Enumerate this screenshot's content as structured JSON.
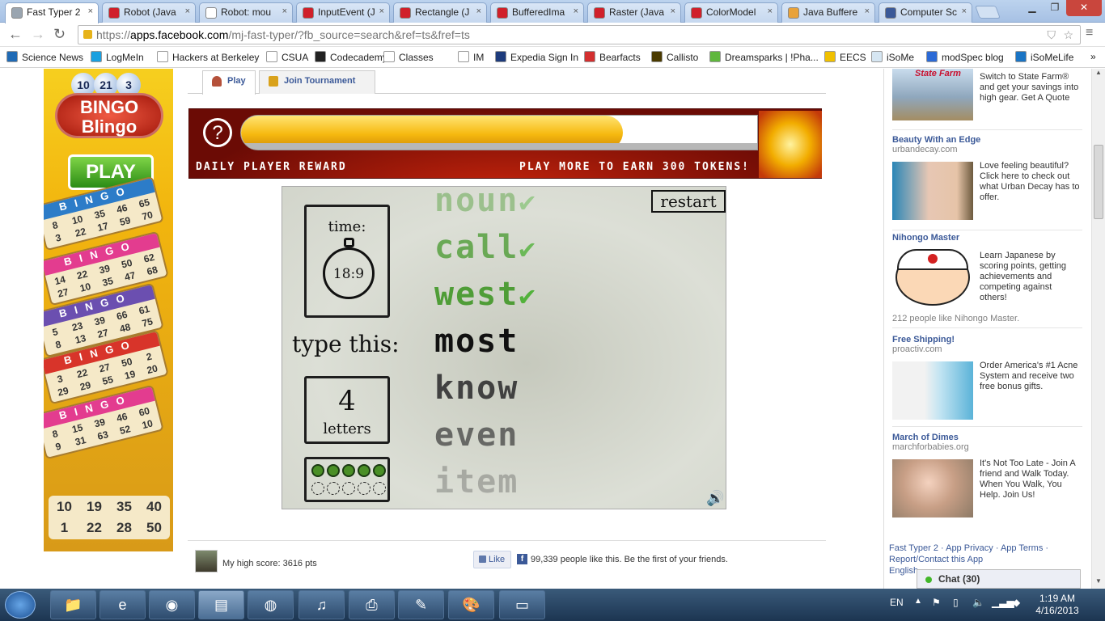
{
  "browser": {
    "tabs": [
      {
        "label": "Fast Typer 2",
        "color": "#9aa5b0",
        "active": true
      },
      {
        "label": "Robot (Java",
        "color": "#d0202a"
      },
      {
        "label": "Robot: mou",
        "color": "#ffffff"
      },
      {
        "label": "InputEvent (J",
        "color": "#d0202a"
      },
      {
        "label": "Rectangle (J",
        "color": "#d0202a"
      },
      {
        "label": "BufferedIma",
        "color": "#d0202a"
      },
      {
        "label": "Raster (Java",
        "color": "#d0202a"
      },
      {
        "label": "ColorModel",
        "color": "#d0202a"
      },
      {
        "label": "Java Buffere",
        "color": "#e8a23a"
      },
      {
        "label": "Computer Sc",
        "color": "#3b5998"
      }
    ],
    "url_prefix": "https://",
    "url_host": "apps.facebook.com",
    "url_path": "/mj-fast-typer/?fb_source=search&ref=ts&fref=ts",
    "bookmarks": [
      {
        "label": "Science News",
        "color": "#1f6ab5"
      },
      {
        "label": "LogMeIn",
        "color": "#1aa0e0"
      },
      {
        "label": "Hackers at Berkeley",
        "color": "#ffffff"
      },
      {
        "label": "CSUA",
        "color": "#ffffff"
      },
      {
        "label": "Codecademy",
        "color": "#222222"
      },
      {
        "label": "Classes",
        "color": "#ffffff"
      },
      {
        "label": "IM",
        "color": "#ffffff"
      },
      {
        "label": "Expedia Sign In",
        "color": "#1d3b7c"
      },
      {
        "label": "Bearfacts",
        "color": "#d32f2f"
      },
      {
        "label": "Callisto",
        "color": "#4a3a00"
      },
      {
        "label": "Dreamsparks | !Pha...",
        "color": "#5fb73d"
      },
      {
        "label": "EECS",
        "color": "#f0c000"
      },
      {
        "label": "iSoMe",
        "color": "#d6e6f2"
      },
      {
        "label": "modSpec blog",
        "color": "#2b6ad6"
      },
      {
        "label": "iSoMeLife",
        "color": "#1a74c4"
      }
    ]
  },
  "left_ad": {
    "ball_numbers": [
      "10",
      "21",
      "3"
    ],
    "logo": "BINGO\nBlingo",
    "play_label": "PLAY",
    "cards": [
      {
        "header": "BINGO",
        "color": "#2c7cc8",
        "nums": [
          "8",
          "10",
          "35",
          "46",
          "65",
          "3",
          "22",
          "17",
          "59",
          "70"
        ]
      },
      {
        "header": "BINGO",
        "color": "#e33c8f",
        "nums": [
          "14",
          "22",
          "39",
          "50",
          "62",
          "27",
          "10",
          "35",
          "47",
          "68"
        ]
      },
      {
        "header": "BINGO",
        "color": "#6b4fb0",
        "nums": [
          "5",
          "23",
          "39",
          "66",
          "61",
          "8",
          "13",
          "27",
          "48",
          "75"
        ]
      },
      {
        "header": "BINGO",
        "color": "#d8342a",
        "nums": [
          "3",
          "22",
          "27",
          "50",
          "2",
          "29",
          "29",
          "55",
          "19",
          "20"
        ]
      },
      {
        "header": "BINGO",
        "color": "#e33c8f",
        "nums": [
          "8",
          "15",
          "39",
          "46",
          "60",
          "9",
          "31",
          "63",
          "52",
          "10"
        ]
      }
    ],
    "bottom_nums": [
      "10",
      "19",
      "35",
      "40",
      "1",
      "22",
      "28",
      "50"
    ]
  },
  "app_tabs": [
    {
      "label": "Play",
      "icon": "person-icon"
    },
    {
      "label": "Join Tournament",
      "icon": "trophy-icon"
    }
  ],
  "reward": {
    "help": "?",
    "left_label": "DAILY PLAYER REWARD",
    "right_label": "PLAY MORE TO EARN 300 TOKENS!",
    "progress": 0.74
  },
  "game": {
    "time_label": "time:",
    "time_value": "18:9",
    "type_this": "type this:",
    "count": "4",
    "count_label": "letters",
    "restart": "restart",
    "dots_filled": 5,
    "dots_empty": 5,
    "words": [
      {
        "text": "noun",
        "state": "done"
      },
      {
        "text": "call",
        "state": "done"
      },
      {
        "text": "west",
        "state": "done"
      },
      {
        "text": "most",
        "state": "current"
      },
      {
        "text": "know",
        "state": "upcoming"
      },
      {
        "text": "even",
        "state": "upcoming"
      },
      {
        "text": "item",
        "state": "upcoming"
      }
    ]
  },
  "footer": {
    "high_score": "My high score: 3616 pts",
    "like_label": "Like",
    "likes_text": "99,339 people like this. Be the first of your friends."
  },
  "sidebar_ads": [
    {
      "title": "",
      "domain": "",
      "body": "Switch to State Farm® and get your savings into high gear. Get A Quote",
      "top_text": "State Farm",
      "img_color": "#9cbbd6"
    },
    {
      "title": "Beauty With an Edge",
      "domain": "urbandecay.com",
      "body": "Love feeling beautiful? Click here to check out what Urban Decay has to offer.",
      "img_color": "#6d6470"
    },
    {
      "title": "Nihongo Master",
      "domain": "",
      "body": "Learn Japanese by scoring points, getting achievements and competing against others!",
      "foot": "212 people like Nihongo Master.",
      "img_color": "#ffffff"
    },
    {
      "title": "Free Shipping!",
      "domain": "proactiv.com",
      "body": "Order America's #1 Acne System and receive two free bonus gifts.",
      "img_color": "#7ec3e0"
    },
    {
      "title": "March of Dimes",
      "domain": "marchforbabies.org",
      "body": "It's Not Too Late - Join A friend and Walk Today. When You Walk, You Help. Join Us!",
      "img_color": "#cdb7a4"
    }
  ],
  "fb_footer": {
    "line1": "Fast Typer 2 · App Privacy · App Terms ·",
    "line2": "Report/Contact this App",
    "lang": "English"
  },
  "chat": "Chat (30)",
  "taskbar": {
    "lang": "EN",
    "time": "1:19 AM",
    "date": "4/16/2013"
  }
}
